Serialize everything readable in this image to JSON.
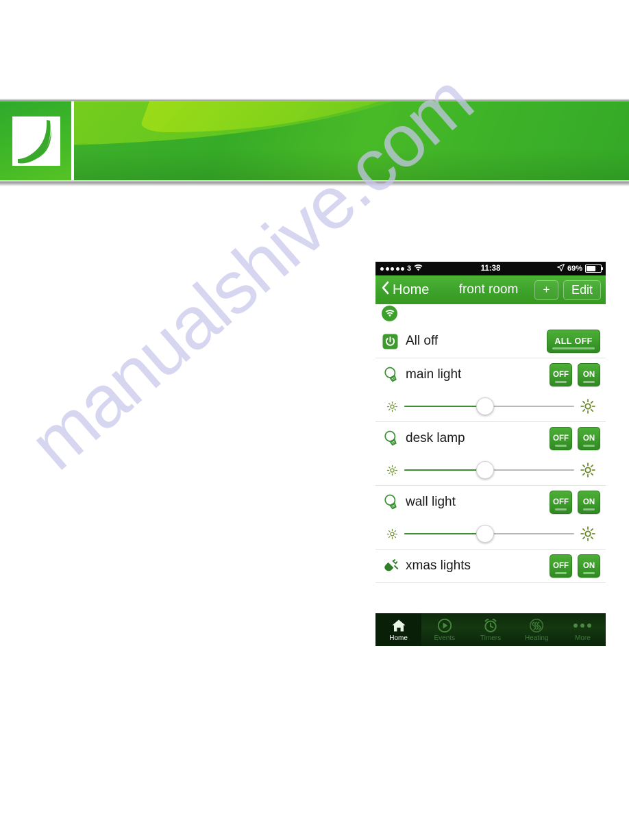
{
  "page": {
    "watermark_text": "manualshive.com",
    "brand_accent": "#3da02b",
    "banner_logo_name": "brand-logo-mark"
  },
  "phone": {
    "status_bar": {
      "signal_dots": 5,
      "carrier": "3",
      "wifi_icon": "wifi-icon",
      "time": "11:38",
      "location_icon": "location-arrow-icon",
      "battery_percent": "69%",
      "battery_icon": "battery-icon"
    },
    "nav_bar": {
      "back_icon": "chevron-left-icon",
      "back_label": "Home",
      "title": "front room",
      "add_label": "+",
      "edit_label": "Edit"
    },
    "connection": {
      "icon": "wifi-status-icon"
    },
    "rows": [
      {
        "icon": "power-icon",
        "label": "All off",
        "buttons": [
          {
            "label": "ALL OFF",
            "size": "wide"
          }
        ],
        "dimmer": null
      },
      {
        "icon": "lightbulb-icon",
        "label": "main light",
        "buttons": [
          {
            "label": "OFF",
            "size": "small"
          },
          {
            "label": "ON",
            "size": "small"
          }
        ],
        "dimmer": {
          "value": 47,
          "low_icon": "sun-dim-icon",
          "high_icon": "sun-bright-icon"
        }
      },
      {
        "icon": "lightbulb-icon",
        "label": "desk lamp",
        "buttons": [
          {
            "label": "OFF",
            "size": "small"
          },
          {
            "label": "ON",
            "size": "small"
          }
        ],
        "dimmer": {
          "value": 47,
          "low_icon": "sun-dim-icon",
          "high_icon": "sun-bright-icon"
        }
      },
      {
        "icon": "lightbulb-icon",
        "label": "wall light",
        "buttons": [
          {
            "label": "OFF",
            "size": "small"
          },
          {
            "label": "ON",
            "size": "small"
          }
        ],
        "dimmer": {
          "value": 47,
          "low_icon": "sun-dim-icon",
          "high_icon": "sun-bright-icon"
        }
      },
      {
        "icon": "plug-icon",
        "label": "xmas lights",
        "buttons": [
          {
            "label": "OFF",
            "size": "small"
          },
          {
            "label": "ON",
            "size": "small"
          }
        ],
        "dimmer": null
      }
    ],
    "tab_bar": {
      "tabs": [
        {
          "label": "Home",
          "icon": "home-icon",
          "active": true
        },
        {
          "label": "Events",
          "icon": "play-icon",
          "active": false
        },
        {
          "label": "Timers",
          "icon": "alarm-clock-icon",
          "active": false
        },
        {
          "label": "Heating",
          "icon": "heat-waves-icon",
          "active": false
        },
        {
          "label": "More",
          "icon": "more-dots-icon",
          "active": false
        }
      ]
    }
  }
}
